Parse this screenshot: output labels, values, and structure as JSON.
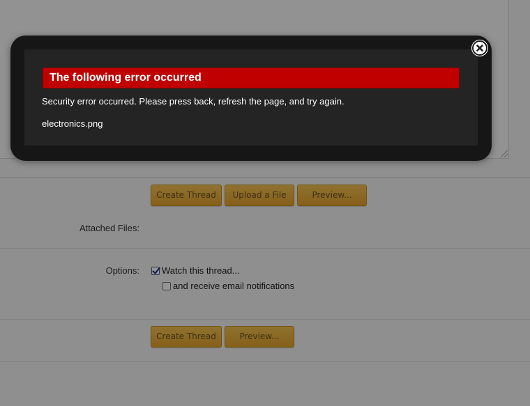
{
  "form": {
    "top_buttons": {
      "create_thread": "Create Thread",
      "upload_file": "Upload a File",
      "preview": "Preview..."
    },
    "attached_files_label": "Attached Files:",
    "options_label": "Options:",
    "options": {
      "watch_thread": {
        "label": "Watch this thread...",
        "checked": true
      },
      "email_notifications": {
        "label": "and receive email notifications",
        "checked": false
      }
    },
    "bottom_buttons": {
      "create_thread": "Create Thread",
      "preview": "Preview..."
    }
  },
  "error_dialog": {
    "title": "The following error occurred",
    "message": "Security error occurred. Please press back, refresh the page, and try again.",
    "file": "electronics.png",
    "close_icon": "close-icon"
  },
  "colors": {
    "button_gold": "#e6a52c",
    "error_red": "#c00000",
    "modal_bg": "#161616"
  }
}
